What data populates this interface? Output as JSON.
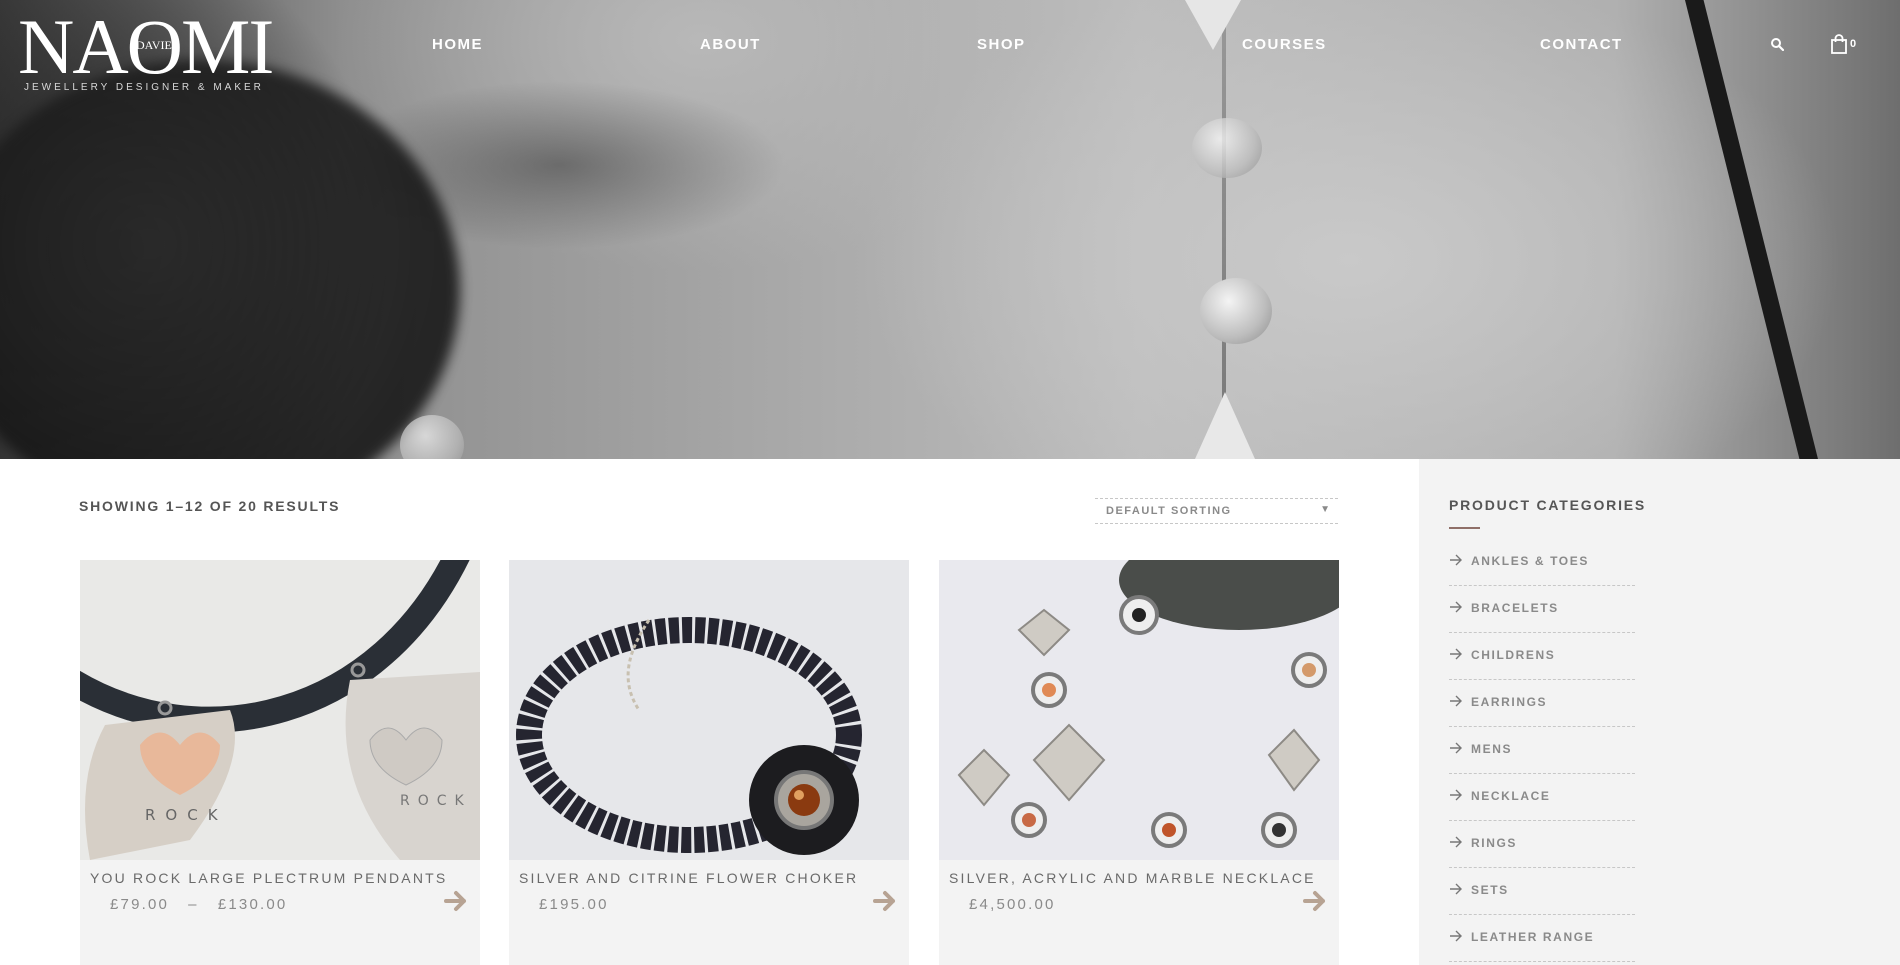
{
  "brand": {
    "name": "NAOMI",
    "surname": "DAVIES",
    "tagline": "JEWELLERY DESIGNER & MAKER"
  },
  "nav": {
    "items": [
      {
        "label": "HOME"
      },
      {
        "label": "ABOUT"
      },
      {
        "label": "SHOP"
      },
      {
        "label": "COURSES"
      },
      {
        "label": "CONTACT"
      }
    ],
    "cart_count": "0",
    "icons": [
      "search-icon",
      "shopping-bag-icon"
    ]
  },
  "shop": {
    "result_count": "SHOWING 1–12 OF 20 RESULTS",
    "sorting": {
      "selected": "DEFAULT SORTING"
    },
    "products": [
      {
        "title": "YOU ROCK LARGE PLECTRUM PENDANTS",
        "price": "£79.00   –   £130.00",
        "image": "plectrum-pendants-photo"
      },
      {
        "title": "SILVER AND CITRINE FLOWER CHOKER",
        "price": "£195.00",
        "image": "flower-choker-photo"
      },
      {
        "title": "SILVER, ACRYLIC AND MARBLE NECKLACE",
        "price": "£4,500.00",
        "image": "marble-necklace-photo"
      }
    ]
  },
  "sidebar": {
    "heading": "PRODUCT CATEGORIES",
    "categories": [
      {
        "label": "ANKLES & TOES"
      },
      {
        "label": "BRACELETS"
      },
      {
        "label": "CHILDRENS"
      },
      {
        "label": "EARRINGS"
      },
      {
        "label": "MENS"
      },
      {
        "label": "NECKLACE"
      },
      {
        "label": "RINGS"
      },
      {
        "label": "SETS"
      },
      {
        "label": "LEATHER RANGE"
      }
    ]
  },
  "colors": {
    "accent_underline": "#8f6f68",
    "arrow_button": "#b7a393",
    "sidebar_bg": "#f3f3f3",
    "card_bg": "#f3f3f3"
  }
}
